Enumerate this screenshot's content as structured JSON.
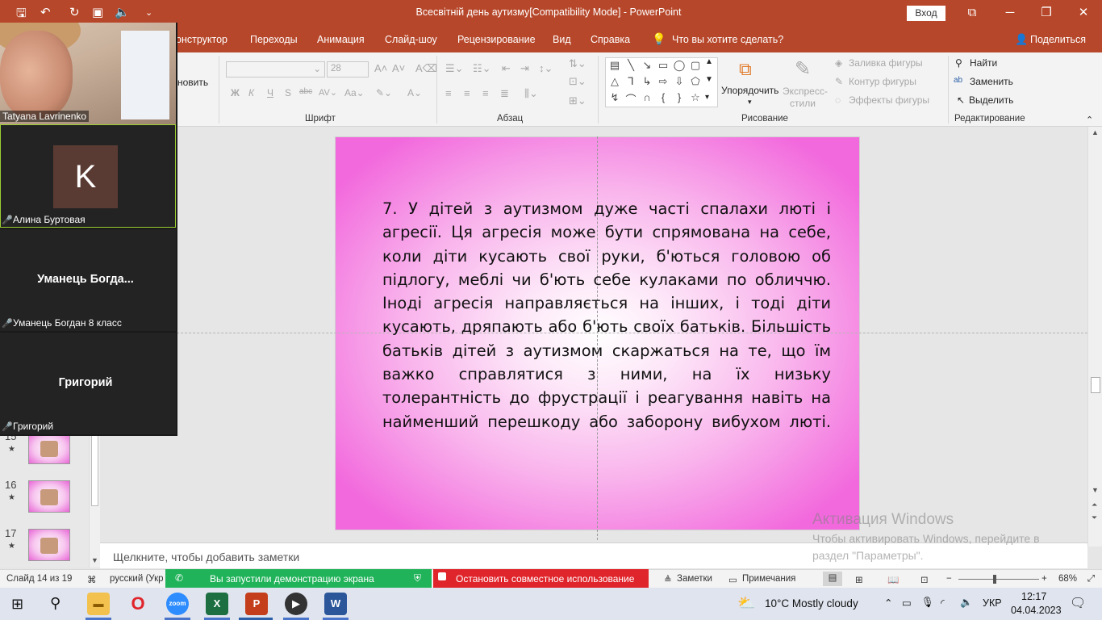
{
  "titlebar": {
    "doc_title": "Всесвітній день аутизму[Compatibility Mode]  -  PowerPoint",
    "signin": "Вход",
    "minimize": "─",
    "restore": "❐",
    "close": "✕"
  },
  "tabs": {
    "items": [
      "онструктор",
      "Переходы",
      "Анимация",
      "Слайд-шоу",
      "Рецензирование",
      "Вид",
      "Справка"
    ],
    "tell_me": "Что вы хотите сделать?",
    "share": "Поделиться"
  },
  "ribbon": {
    "partial_button": "новить",
    "font_group": "Шрифт",
    "font_size": "28",
    "paragraph_group": "Абзац",
    "drawing_group": "Рисование",
    "arrange": "Упорядочить",
    "quick_styles_1": "Экспресс-",
    "quick_styles_2": "стили",
    "fill": "Заливка фигуры",
    "outline": "Контур фигуры",
    "effects": "Эффекты фигуры",
    "editing_group": "Редактирование",
    "find": "Найти",
    "replace": "Заменить",
    "select": "Выделить"
  },
  "thumbnails": [
    {
      "num": "15",
      "star": "★"
    },
    {
      "num": "16",
      "star": "★"
    },
    {
      "num": "17",
      "star": "★"
    }
  ],
  "slide": {
    "text": "7. У дітей з аутизмом дуже часті спалахи люті і агресії. Ця агресія може бути спрямована на себе, коли діти кусають свої руки, б'ються головою об підлогу, меблі чи б'ють себе кулаками по обличчю. Іноді агресія направляється на інших, і тоді діти кусають, дряпають або б'ють своїх батьків. Більшість батьків дітей з аутизмом скаржаться на те, що їм важко справлятися з ними, на їх низьку толерантність до фрустрації і реагування навіть на найменший перешкоду або заборону вибухом люті."
  },
  "notes": {
    "placeholder": "Щелкните, чтобы добавить заметки"
  },
  "watermark": {
    "line1": "Активация Windows",
    "line2": "Чтобы активировать Windows, перейдите в раздел \"Параметры\"."
  },
  "statusbar": {
    "slide_info": "Слайд 14 из 19",
    "language": "русский (Укр",
    "share_status": "Вы запустили демонстрацию экрана",
    "stop_share": "Остановить совместное использование",
    "notes_btn": "Заметки",
    "comments_btn": "Примечания",
    "zoom_level": "68%",
    "zoom_fraction": 0.45
  },
  "zoom": {
    "participants": [
      {
        "name": "Tatyana Lavrinenko"
      },
      {
        "name": "Алина Буртовая",
        "initial": "K"
      },
      {
        "name": "Уманець Богдан 8 класс",
        "tile_title": "Уманець  Богда..."
      },
      {
        "name": "Григорий",
        "tile_title": "Григорий"
      }
    ]
  },
  "taskbar": {
    "weather": "10°C  Mostly cloudy",
    "lang": "УКР",
    "time": "12:17",
    "date": "04.04.2023"
  },
  "colors": {
    "accent": "#b7472a",
    "share_green": "#21b35a",
    "share_red": "#e0242b"
  }
}
